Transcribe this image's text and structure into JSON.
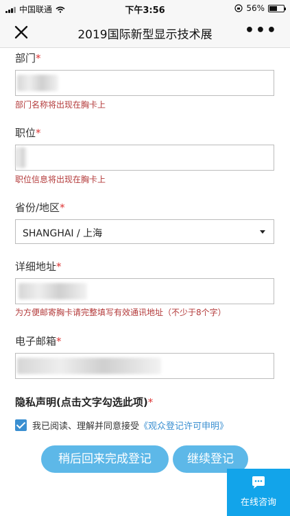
{
  "status_bar": {
    "carrier": "中国联通",
    "time": "下午3:56",
    "battery": "56%"
  },
  "header": {
    "title": "2019国际新型显示技术展"
  },
  "form": {
    "department": {
      "label": "部门",
      "required": "*",
      "hint": "部门名称将出现在胸卡上"
    },
    "position": {
      "label": "职位",
      "required": "*",
      "hint": "职位信息将出现在胸卡上"
    },
    "province": {
      "label": "省份/地区",
      "required": "*",
      "selected": "SHANGHAI / 上海"
    },
    "address": {
      "label": "详细地址",
      "required": "*",
      "hint": "为方便邮寄胸卡请完整填写有效通讯地址（不少于8个字）"
    },
    "email": {
      "label": "电子邮箱",
      "required": "*"
    },
    "privacy": {
      "title": "隐私声明(点击文字勾选此项)",
      "required": "*",
      "consent_text": "我已阅读、理解并同意接受",
      "consent_link": "《观众登记许可申明》"
    }
  },
  "buttons": {
    "later": "稍后回来完成登记",
    "continue": "继续登记"
  },
  "chat": {
    "label": "在线咨询"
  }
}
